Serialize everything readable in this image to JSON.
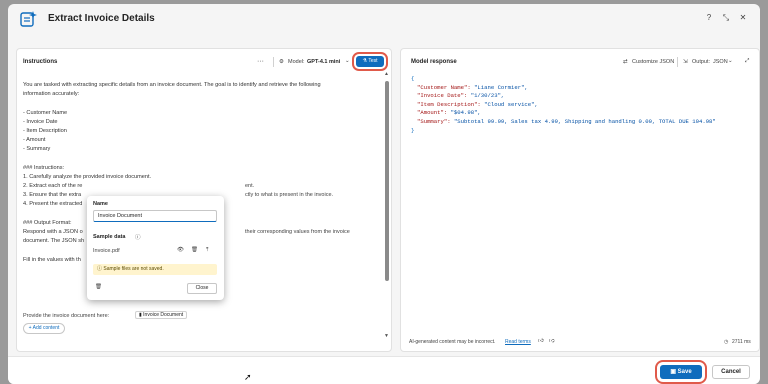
{
  "dialog": {
    "title": "Extract Invoice Details",
    "icons": [
      "sparkle-app-icon",
      "help-icon",
      "collapse-icon",
      "close-icon"
    ]
  },
  "left": {
    "header": "Instructions",
    "more": "···",
    "model_label": "Model:",
    "model_value": "GPT-4.1 mini",
    "test_label": "Test",
    "lines": [
      "You are tasked with extracting specific details from an invoice document. The goal is to identify and retrieve the following",
      "information accurately:",
      "",
      "- Customer Name",
      "- Invoice Date",
      "- Item Description",
      "- Amount",
      "- Summary",
      "",
      "### Instructions:",
      "1. Carefully analyze the provided invoice document.",
      "2. Extract each of the re",
      "3. Ensure that the extra",
      "4. Present the extracted",
      "",
      "### Output Format:",
      "Respond with a JSON o",
      "document. The JSON sh",
      "",
      "Fill in the values with th",
      ""
    ],
    "hidden_tails": {
      "line11": "ent.",
      "line12": "ctly to what is present in the invoice.",
      "line16": "their corresponding values from the invoice"
    },
    "provide_text": "Provide the invoice document here:",
    "provide_chip": "Invoice Document",
    "add_content": "Add content"
  },
  "popup": {
    "name_label": "Name",
    "name_value": "Invoice Document",
    "sample_label": "Sample data",
    "file_name": "Invoice.pdf",
    "warning": "Sample files are not saved.",
    "close_label": "Close"
  },
  "right": {
    "header": "Model response",
    "customize": "Customize JSON",
    "output_label": "Output:",
    "output_value": "JSON",
    "json_lines": [
      {
        "k": "",
        "v": "{"
      },
      {
        "k": "\"Customer Name\": ",
        "v": "\"Liane Cormier\","
      },
      {
        "k": "\"Invoice Date\": ",
        "v": "\"1/30/23\","
      },
      {
        "k": "\"Item Description\": ",
        "v": "\"Cloud service\","
      },
      {
        "k": "\"Amount\": ",
        "v": "\"$04.98\","
      },
      {
        "k": "\"Summary\": ",
        "v": "\"Subtotal 99.99, Sales tax 4.99, Shipping and handling 0.00, TOTAL DUE 104.98\""
      },
      {
        "k": "",
        "v": "}"
      }
    ],
    "disclaimer": "AI-generated content may be incorrect.",
    "terms": "Read terms",
    "timing": "2711 ms"
  },
  "footer": {
    "save": "Save",
    "cancel": "Cancel"
  },
  "colors": {
    "accent": "#0f6cbd",
    "highlight": "#e05a4a"
  }
}
